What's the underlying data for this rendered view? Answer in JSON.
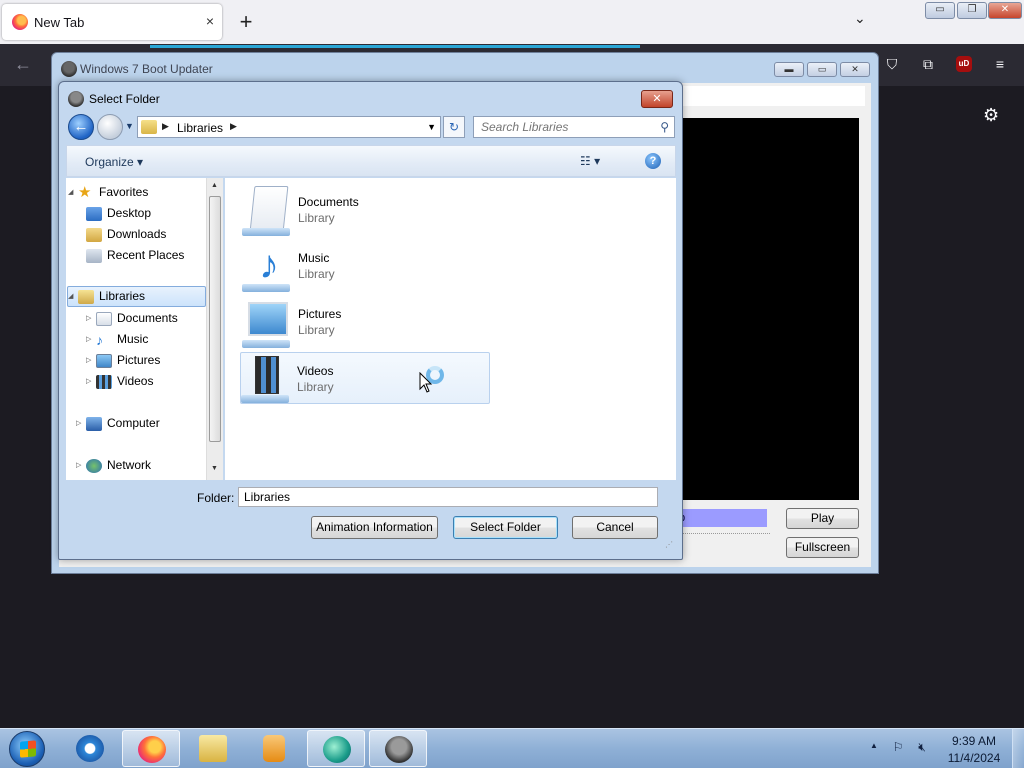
{
  "browser": {
    "tab_title": "New Tab",
    "tab_close_icon": "×",
    "new_tab_icon": "+",
    "list_tabs_icon": "⌄",
    "window_buttons": {
      "minimize": "▭",
      "restore": "❐",
      "close": "✕"
    },
    "toolbar_icons": [
      "pocket-icon",
      "extensions-icon",
      "ublock-icon",
      "menu-icon"
    ],
    "ublock_label": "uD",
    "accent_color": "#2aa7d6"
  },
  "app_window": {
    "title": "Windows 7 Boot Updater",
    "progress_text": "p",
    "play_label": "Play",
    "fullscreen_label": "Fullscreen"
  },
  "dialog": {
    "title": "Select Folder",
    "close_symbol": "✕",
    "address": {
      "breadcrumb": "Libraries"
    },
    "search": {
      "placeholder": "Search Libraries"
    },
    "organize_label": "Organize",
    "nav_tree": [
      {
        "label": "Favorites",
        "icon": "star-icon",
        "level": 0,
        "expanded": true
      },
      {
        "label": "Desktop",
        "icon": "desktop-icon",
        "level": 1
      },
      {
        "label": "Downloads",
        "icon": "downloads-icon",
        "level": 1
      },
      {
        "label": "Recent Places",
        "icon": "recent-places-icon",
        "level": 1
      },
      {
        "label": "Libraries",
        "icon": "libraries-icon",
        "level": 0,
        "expanded": true,
        "selected": true
      },
      {
        "label": "Documents",
        "icon": "documents-icon",
        "level": 1
      },
      {
        "label": "Music",
        "icon": "music-icon",
        "level": 1
      },
      {
        "label": "Pictures",
        "icon": "pictures-icon",
        "level": 1
      },
      {
        "label": "Videos",
        "icon": "videos-icon",
        "level": 1
      },
      {
        "label": "Computer",
        "icon": "computer-icon",
        "level": 0
      },
      {
        "label": "Network",
        "icon": "network-icon",
        "level": 0
      }
    ],
    "libraries": [
      {
        "name": "Documents",
        "type": "Library",
        "icon": "documents-library-icon"
      },
      {
        "name": "Music",
        "type": "Library",
        "icon": "music-library-icon"
      },
      {
        "name": "Pictures",
        "type": "Library",
        "icon": "pictures-library-icon"
      },
      {
        "name": "Videos",
        "type": "Library",
        "icon": "videos-library-icon",
        "hovered": true
      }
    ],
    "folder_label": "Folder:",
    "folder_value": "Libraries",
    "buttons": {
      "animation_info": "Animation Information",
      "select_folder": "Select Folder",
      "cancel": "Cancel"
    }
  },
  "taskbar": {
    "pinned": [
      "internet-explorer-icon",
      "firefox-icon",
      "file-explorer-icon",
      "media-player-icon",
      "teal-app-icon",
      "boot-updater-icon"
    ],
    "active": [
      "firefox-icon",
      "teal-app-icon",
      "boot-updater-icon"
    ],
    "clock_time": "9:39 AM",
    "clock_date": "11/4/2024"
  }
}
